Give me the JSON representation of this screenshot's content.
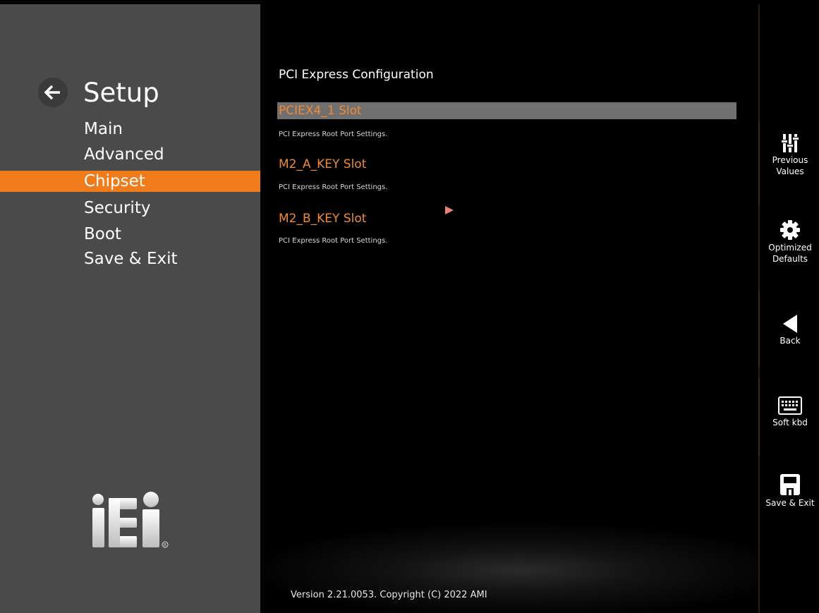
{
  "sidebar": {
    "title": "Setup",
    "items": [
      {
        "label": "Main",
        "active": false
      },
      {
        "label": "Advanced",
        "active": false
      },
      {
        "label": "Chipset",
        "active": true
      },
      {
        "label": "Security",
        "active": false
      },
      {
        "label": "Boot",
        "active": false
      },
      {
        "label": "Save & Exit",
        "active": false
      }
    ],
    "logo": "iEi",
    "accent_color": "#f07b1b"
  },
  "main": {
    "title": "PCI Express Configuration",
    "entries": [
      {
        "label": "PCIEX4_1 Slot",
        "help": "PCI Express Root Port Settings.",
        "selected": true
      },
      {
        "label": "M2_A_KEY Slot",
        "help": "PCI Express Root Port Settings.",
        "selected": false
      },
      {
        "label": "M2_B_KEY Slot",
        "help": "PCI Express Root Port Settings.",
        "selected": false
      }
    ],
    "version": "Version 2.21.0053. Copyright (C) 2022 AMI"
  },
  "toolbar": {
    "previous_values": {
      "label_1": "Previous",
      "label_2": "Values",
      "icon": "sliders-icon"
    },
    "optimized_defaults": {
      "label_1": "Optimized",
      "label_2": "Defaults",
      "icon": "gear-icon"
    },
    "back": {
      "label": "Back",
      "icon": "triangle-left-icon"
    },
    "soft_kbd": {
      "label": "Soft kbd",
      "icon": "keyboard-icon"
    },
    "save_exit": {
      "label": "Save & Exit",
      "icon": "floppy-disk-icon"
    }
  }
}
